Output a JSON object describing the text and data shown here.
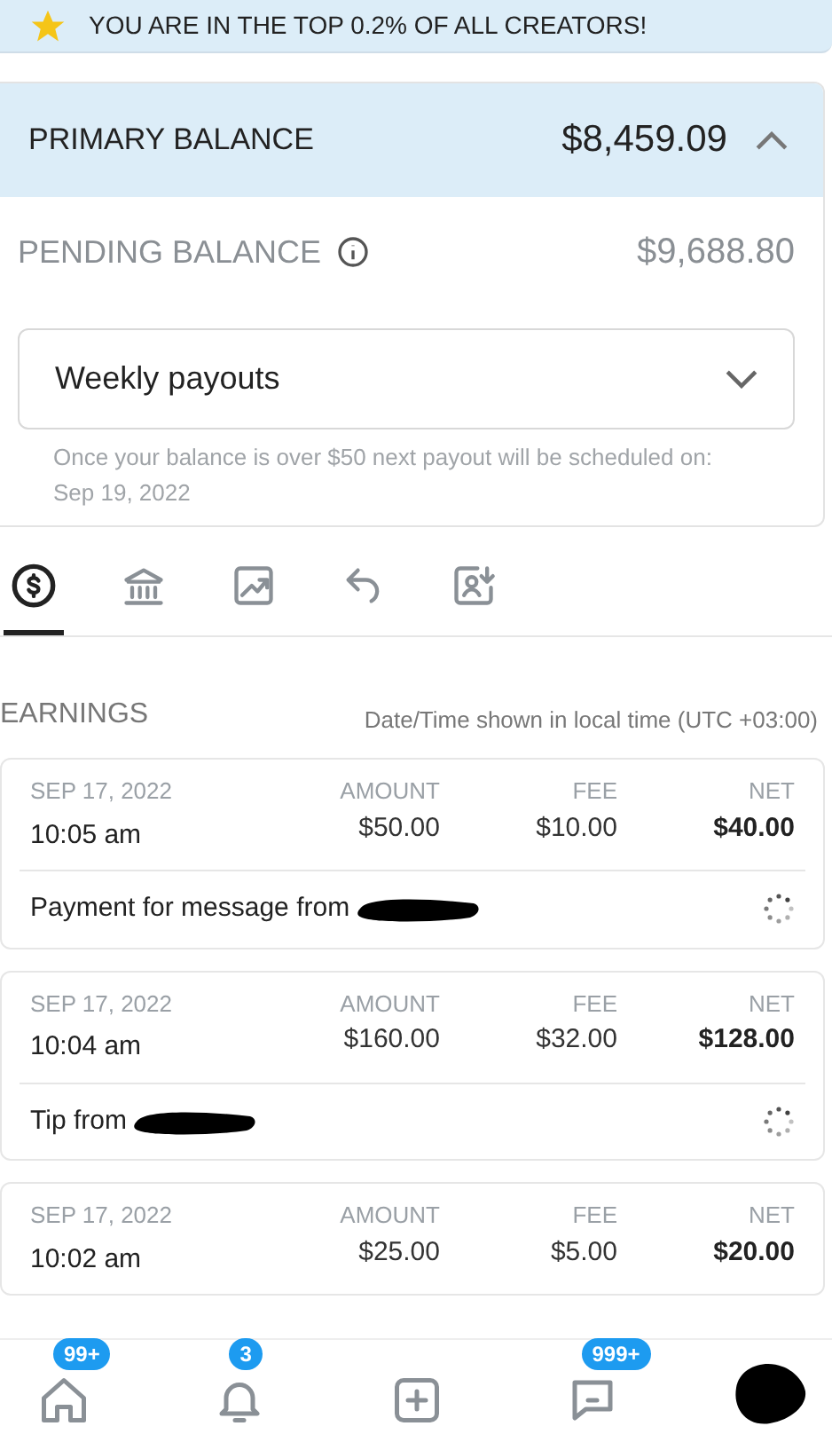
{
  "banner": {
    "text": "YOU ARE IN THE TOP 0.2% OF ALL CREATORS!"
  },
  "primary_balance": {
    "label": "PRIMARY BALANCE",
    "amount": "$8,459.09",
    "expanded": true
  },
  "pending_balance": {
    "label": "PENDING BALANCE",
    "amount": "$9,688.80"
  },
  "payout_select": {
    "value": "Weekly payouts"
  },
  "payout_hint": "Once your balance is over $50 next payout will be scheduled on: Sep 19, 2022",
  "tabs": [
    {
      "selected": true
    },
    {
      "selected": false
    },
    {
      "selected": false
    },
    {
      "selected": false
    },
    {
      "selected": false
    }
  ],
  "earnings": {
    "title": "EARNINGS",
    "timezone_note": "Date/Time shown in local time (UTC +03:00)"
  },
  "transactions": [
    {
      "date": "SEP 17, 2022",
      "time": "10:05 am",
      "amount_label": "AMOUNT",
      "amount": "$50.00",
      "fee_label": "FEE",
      "fee": "$10.00",
      "net_label": "NET",
      "net": "$40.00",
      "description": "Payment for message from",
      "pending": true
    },
    {
      "date": "SEP 17, 2022",
      "time": "10:04 am",
      "amount_label": "AMOUNT",
      "amount": "$160.00",
      "fee_label": "FEE",
      "fee": "$32.00",
      "net_label": "NET",
      "net": "$128.00",
      "description": "Tip from",
      "pending": true
    },
    {
      "date": "SEP 17, 2022",
      "time": "10:02 am",
      "amount_label": "AMOUNT",
      "amount": "$25.00",
      "fee_label": "FEE",
      "fee": "$5.00",
      "net_label": "NET",
      "net": "$20.00"
    }
  ],
  "nav_badges": {
    "home": "99+",
    "notifications": "3",
    "messages": "999+"
  }
}
